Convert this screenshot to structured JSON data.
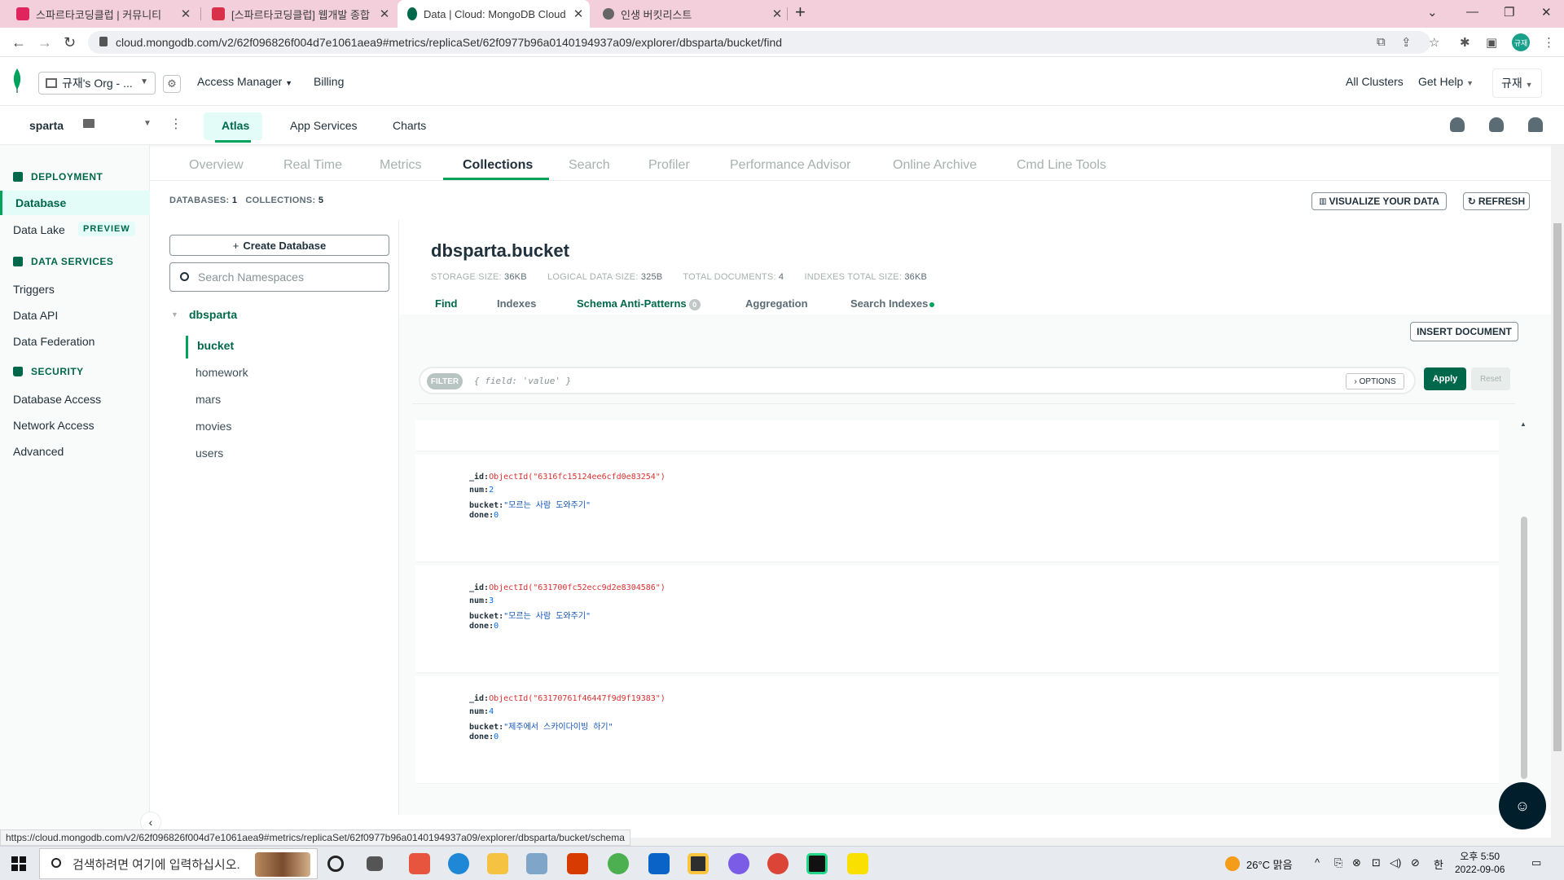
{
  "browser": {
    "tabs": [
      {
        "title": "스파르타코딩클럽 | 커뮤니티",
        "color": "#e0245e"
      },
      {
        "title": "[스파르타코딩클럽] 웹개발 종합",
        "color": "#d93049"
      },
      {
        "title": "Data | Cloud: MongoDB Cloud",
        "color": "#00684a"
      },
      {
        "title": "인생 버킷리스트",
        "color": "#666666"
      }
    ],
    "url": "cloud.mongodb.com/v2/62f096826f004d7e1061aea9#metrics/replicaSet/62f0977b96a0140194937a09/explorer/dbsparta/bucket/find",
    "profile_initials": "규재",
    "status_url": "https://cloud.mongodb.com/v2/62f096826f004d7e1061aea9#metrics/replicaSet/62f0977b96a0140194937a09/explorer/dbsparta/bucket/schema"
  },
  "header": {
    "org": "규재's Org - ...",
    "access_manager": "Access Manager",
    "billing": "Billing",
    "all_clusters": "All Clusters",
    "get_help": "Get Help",
    "user": "규재"
  },
  "project_bar": {
    "project": "sparta",
    "tabs": [
      "Atlas",
      "App Services",
      "Charts"
    ]
  },
  "sidebar": {
    "deployment_heading": "DEPLOYMENT",
    "database": "Database",
    "data_lake": "Data Lake",
    "preview_badge": "PREVIEW",
    "data_services_heading": "DATA SERVICES",
    "triggers": "Triggers",
    "data_api": "Data API",
    "data_federation": "Data Federation",
    "security_heading": "SECURITY",
    "database_access": "Database Access",
    "network_access": "Network Access",
    "advanced": "Advanced"
  },
  "subtabs": [
    "Overview",
    "Real Time",
    "Metrics",
    "Collections",
    "Search",
    "Profiler",
    "Performance Advisor",
    "Online Archive",
    "Cmd Line Tools"
  ],
  "counts": {
    "databases_label": "DATABASES:",
    "databases": "1",
    "collections_label": "COLLECTIONS:",
    "collections": "5"
  },
  "buttons": {
    "visualize": "VISUALIZE YOUR DATA",
    "refresh": "REFRESH",
    "insert": "INSERT DOCUMENT",
    "apply": "Apply",
    "reset": "Reset",
    "options": "OPTIONS",
    "create_db": "Create Database"
  },
  "namespaces": {
    "search_placeholder": "Search Namespaces",
    "database": "dbsparta",
    "collections": [
      "bucket",
      "homework",
      "mars",
      "movies",
      "users"
    ]
  },
  "collection": {
    "title": "dbsparta.bucket",
    "storage_label": "STORAGE SIZE:",
    "storage": "36KB",
    "logical_label": "LOGICAL DATA SIZE:",
    "logical": "325B",
    "docs_label": "TOTAL DOCUMENTS:",
    "docs": "4",
    "index_label": "INDEXES TOTAL SIZE:",
    "index": "36KB",
    "tabs": [
      "Find",
      "Indexes",
      "Schema Anti-Patterns",
      "Aggregation",
      "Search Indexes"
    ],
    "antipattern_count": "0"
  },
  "filter": {
    "label": "FILTER",
    "placeholder": "{ field: 'value' }"
  },
  "documents": [
    {
      "id": "ObjectId(\"6316fc15124ee6cfd0e83254\")",
      "num": "2",
      "bucket": "\"모르는 사람 도와주기\"",
      "done": "0"
    },
    {
      "id": "ObjectId(\"631700fc52ecc9d2e8304586\")",
      "num": "3",
      "bucket": "\"모르는 사람 도와주기\"",
      "done": "0"
    },
    {
      "id": "ObjectId(\"63170761f46447f9d9f19383\")",
      "num": "4",
      "bucket": "\"제주에서 스카이다이빙 하기\"",
      "done": "0"
    }
  ],
  "field_keys": {
    "id": "_id:",
    "num": "num:",
    "bucket": "bucket:",
    "done": "done:"
  },
  "taskbar": {
    "search_placeholder": "검색하려면 여기에 입력하십시오.",
    "weather": "26°C 맑음",
    "ime": "한",
    "time": "오후 5:50",
    "date": "2022-09-06"
  }
}
